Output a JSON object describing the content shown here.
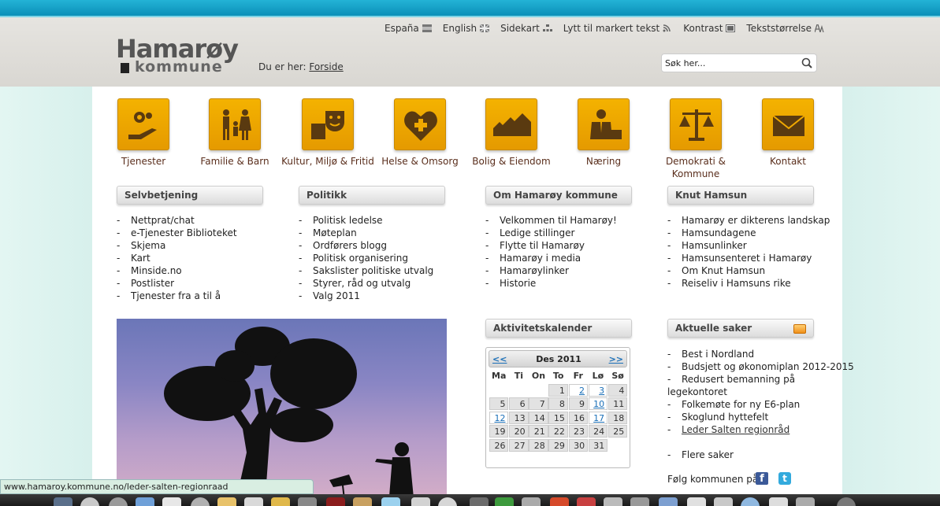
{
  "header": {
    "logo_top": "Hamarøy",
    "logo_bottom": "kommune",
    "breadcrumb_prefix": "Du er her:",
    "breadcrumb_link": "Forside",
    "nav": [
      "España",
      "English",
      "Sidekart",
      "Lytt til markert tekst",
      "Kontrast",
      "Tekststørrelse"
    ],
    "search_placeholder": "Søk her..."
  },
  "categories": [
    "Tjenester",
    "Familie & Barn",
    "Kultur, Miljø & Fritid",
    "Helse & Omsorg",
    "Bolig & Eiendom",
    "Næring",
    "Demokrati & Kommune",
    "Kontakt"
  ],
  "boxes": {
    "selvbetjening": {
      "title": "Selvbetjening",
      "items": [
        "Nettprat/chat",
        "e-Tjenester Biblioteket",
        "Skjema",
        "Kart",
        "Minside.no",
        "Postlister",
        "Tjenester fra a til å"
      ]
    },
    "politikk": {
      "title": "Politikk",
      "items": [
        "Politisk ledelse",
        "Møteplan",
        "Ordførers blogg",
        "Politisk organisering",
        "Sakslister politiske utvalg",
        "Styrer, råd og utvalg",
        "Valg 2011"
      ]
    },
    "om": {
      "title": "Om Hamarøy kommune",
      "items": [
        "Velkommen til Hamarøy!",
        "Ledige stillinger",
        "Flytte til Hamarøy",
        "Hamarøy i media",
        "Hamarøylinker",
        "Historie"
      ]
    },
    "knut": {
      "title": "Knut Hamsun",
      "items": [
        "Hamarøy er dikterens landskap",
        "Hamsundagene",
        "Hamsunlinker",
        "Hamsunsenteret i Hamarøy",
        "Om Knut Hamsun",
        "Reiseliv i Hamsuns rike"
      ]
    },
    "aktivitet": {
      "title": "Aktivitetskalender"
    },
    "aktuelle": {
      "title": "Aktuelle saker",
      "items": [
        "Best i Nordland",
        "Budsjett og økonomiplan 2012-2015",
        "Redusert bemanning på",
        "Folkemøte for ny E6-plan",
        "Skoglund hyttefelt",
        "Leder Salten regionråd"
      ],
      "item3_cont": "legekontoret",
      "more": "Flere saker",
      "follow": "Følg kommunen på:"
    }
  },
  "calendar": {
    "title": "Des 2011",
    "prev": "<<",
    "next": ">>",
    "dow": [
      "Ma",
      "Ti",
      "On",
      "To",
      "Fr",
      "Lø",
      "Sø"
    ],
    "weeks": [
      [
        "",
        "",
        "",
        "1",
        "2",
        "3",
        "4"
      ],
      [
        "5",
        "6",
        "7",
        "8",
        "9",
        "10",
        "11"
      ],
      [
        "12",
        "13",
        "14",
        "15",
        "16",
        "17",
        "18"
      ],
      [
        "19",
        "20",
        "21",
        "22",
        "23",
        "24",
        "25"
      ],
      [
        "26",
        "27",
        "28",
        "29",
        "30",
        "31",
        ""
      ]
    ],
    "linked_days": [
      "2",
      "3",
      "10",
      "12",
      "17"
    ]
  },
  "status_url": "www.hamaroy.kommune.no/leder-salten-regionraad"
}
